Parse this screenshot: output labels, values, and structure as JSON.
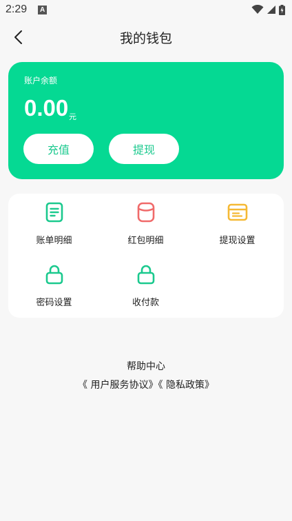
{
  "status_bar": {
    "time": "2:29",
    "notification_letter": "A"
  },
  "nav": {
    "title": "我的钱包"
  },
  "balance": {
    "label": "账户余额",
    "amount": "0.00",
    "unit": "元",
    "recharge_label": "充值",
    "withdraw_label": "提现"
  },
  "menu": {
    "items": [
      {
        "label": "账单明细",
        "icon": "bill-icon",
        "color": "#1bc98e"
      },
      {
        "label": "红包明细",
        "icon": "red-packet-icon",
        "color": "#f06a6a"
      },
      {
        "label": "提现设置",
        "icon": "card-icon",
        "color": "#f5b935"
      },
      {
        "label": "密码设置",
        "icon": "lock-icon",
        "color": "#1bc98e"
      },
      {
        "label": "收付款",
        "icon": "lock-icon",
        "color": "#1bc98e"
      }
    ]
  },
  "footer": {
    "help_center": "帮助中心",
    "user_agreement": "《 用户服务协议》",
    "privacy_policy": "《 隐私政策》"
  },
  "colors": {
    "accent": "#05d993",
    "button_text": "#1bc98e"
  }
}
